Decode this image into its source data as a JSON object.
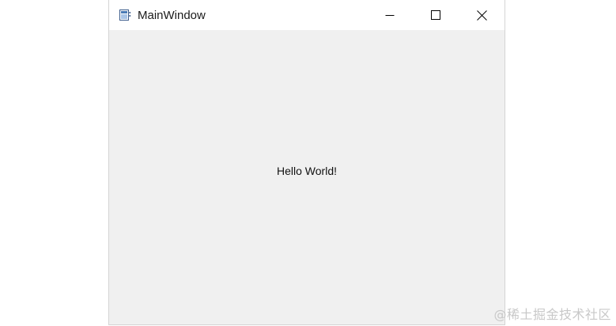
{
  "window": {
    "title": "MainWindow",
    "icon": "app-window-icon",
    "controls": [
      "minimize-icon",
      "maximize-icon",
      "close-icon"
    ]
  },
  "content": {
    "label": "Hello World!"
  },
  "watermark": {
    "text": "@稀土掘金技术社区"
  }
}
